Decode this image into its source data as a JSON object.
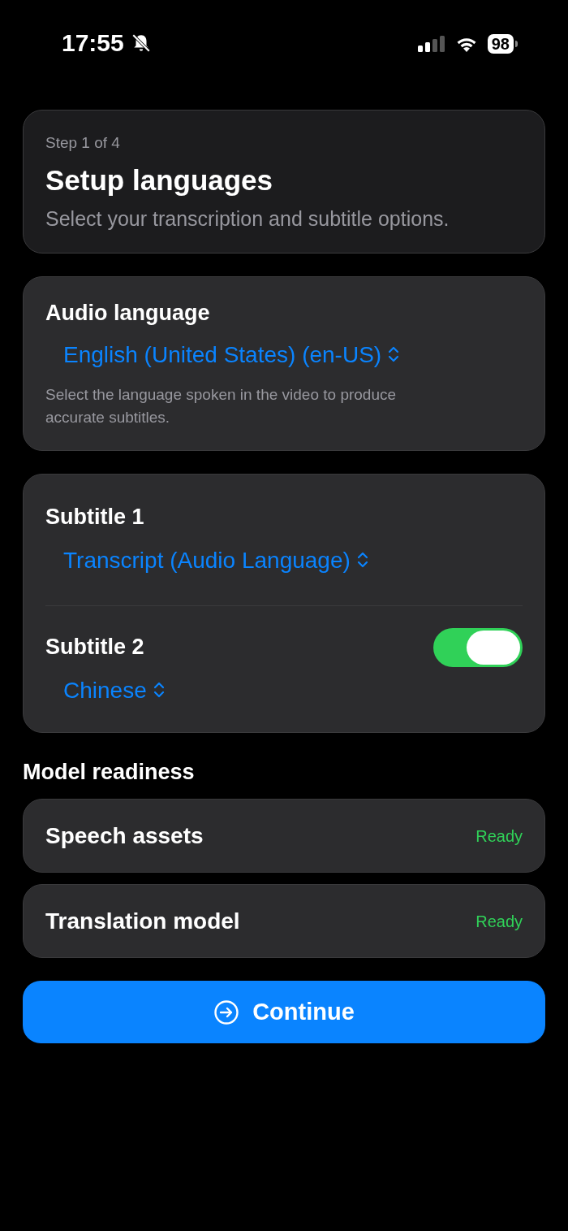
{
  "status_bar": {
    "time": "17:55",
    "battery": "98"
  },
  "header": {
    "step": "Step 1 of 4",
    "title": "Setup languages",
    "subtitle": "Select your transcription and subtitle options."
  },
  "audio_language": {
    "label": "Audio language",
    "value": "English (United States) (en-US)",
    "hint": "Select the language spoken in the video to produce accurate subtitles."
  },
  "subtitles": [
    {
      "label": "Subtitle 1",
      "value": "Transcript (Audio Language)"
    },
    {
      "label": "Subtitle 2",
      "value": "Chinese",
      "on": true
    }
  ],
  "model_readiness": {
    "heading": "Model readiness",
    "items": [
      {
        "name": "Speech assets",
        "status": "Ready",
        "ready": true
      },
      {
        "name": "Translation model",
        "status": "Ready",
        "ready": true
      }
    ]
  },
  "continue_button": {
    "label": "Continue"
  }
}
